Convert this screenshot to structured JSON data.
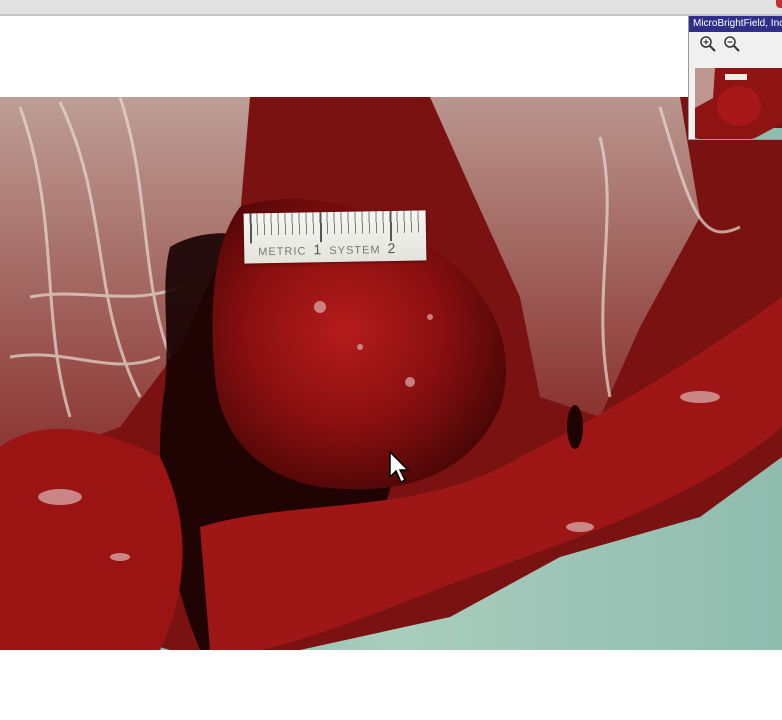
{
  "navigator": {
    "title": "MicroBrightField, Inc",
    "zoom_in_icon": "zoom-in-icon",
    "zoom_out_icon": "zoom-out-icon"
  },
  "specimen": {
    "ruler": {
      "word1": "METRIC",
      "num1": "1",
      "word2": "SYSTEM",
      "num2": "2"
    }
  },
  "colors": {
    "title_bar": "#2f2f8a",
    "tissue_dark": "#3a0606",
    "tissue_red": "#9b1414",
    "background_teal": "#9cc3b6"
  }
}
